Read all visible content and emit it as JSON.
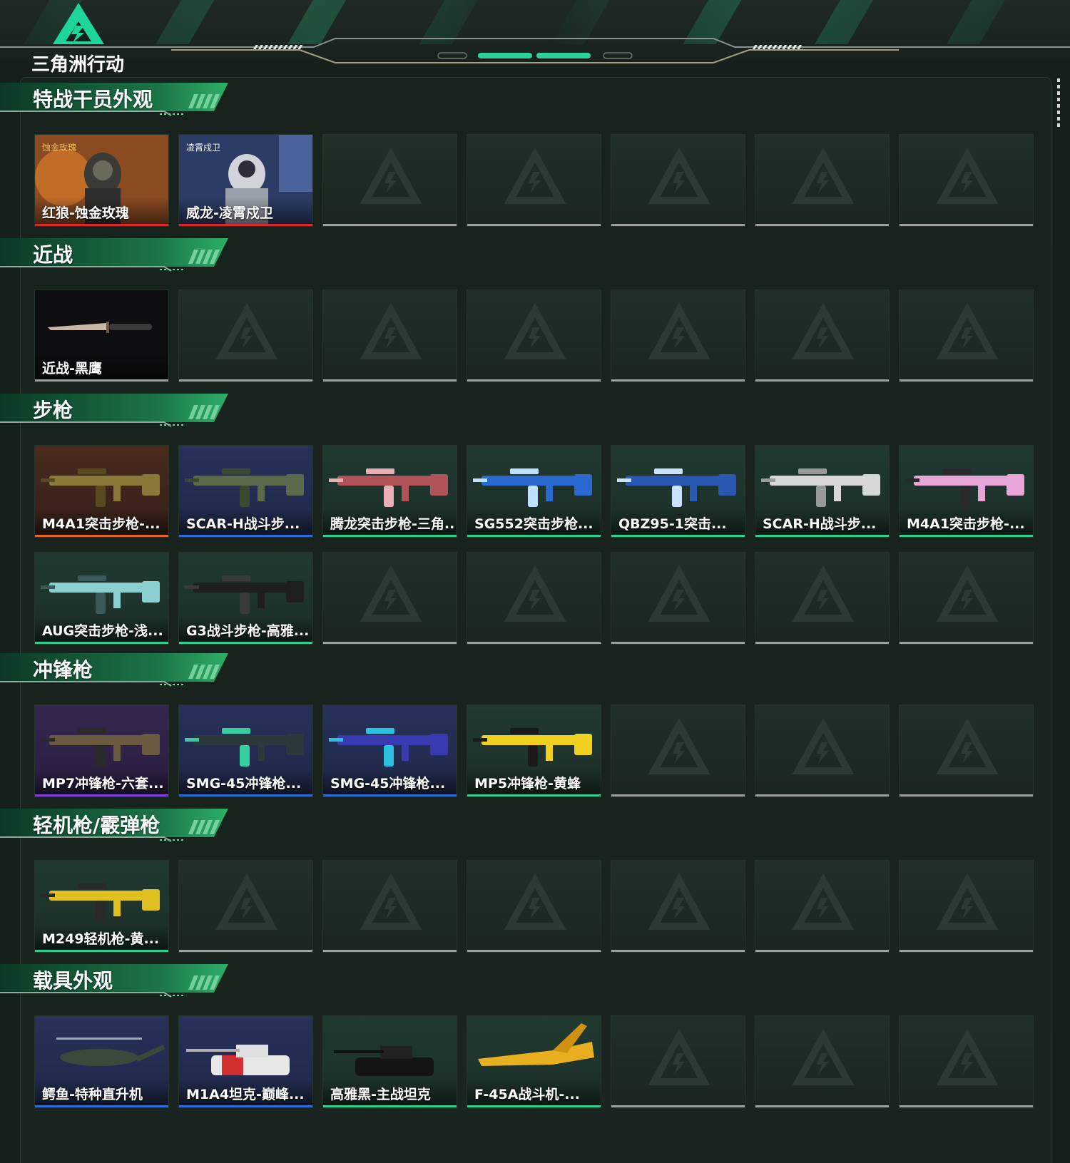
{
  "brand": {
    "name": "三角洲行动"
  },
  "colors": {
    "gold": "#e0632a",
    "red": "#d8262a",
    "blue": "#2e6bd6",
    "green": "#2fcf8b",
    "purple": "#7b3fe0",
    "gray": "#9aa19d",
    "accent": "#22c98a"
  },
  "sections": [
    {
      "title": "特战干员外观",
      "rows": [
        [
          {
            "label": "红狼-蚀金玫瑰",
            "rarity": "red",
            "art": "operator-redwolf"
          },
          {
            "label": "威龙-凌霄戍卫",
            "rarity": "red",
            "art": "operator-weilong"
          },
          null,
          null,
          null,
          null,
          null
        ]
      ]
    },
    {
      "title": "近战",
      "rows": [
        [
          {
            "label": "近战-黑鹰",
            "rarity": "gray",
            "art": "knife"
          },
          null,
          null,
          null,
          null,
          null,
          null
        ]
      ]
    },
    {
      "title": "步枪",
      "rows": [
        [
          {
            "label": "M4A1突击步枪-...",
            "rarity": "gold",
            "art": "rifle-gold"
          },
          {
            "label": "SCAR-H战斗步...",
            "rarity": "blue",
            "art": "rifle-green"
          },
          {
            "label": "腾龙突击步枪-三角...",
            "rarity": "green",
            "art": "rifle-red"
          },
          {
            "label": "SG552突击步枪...",
            "rarity": "green",
            "art": "rifle-blue"
          },
          {
            "label": "QBZ95-1突击...",
            "rarity": "green",
            "art": "bullpup-blue"
          },
          {
            "label": "SCAR-H战斗步...",
            "rarity": "green",
            "art": "rifle-white"
          },
          {
            "label": "M4A1突击步枪-...",
            "rarity": "green",
            "art": "rifle-pink"
          }
        ],
        [
          {
            "label": "AUG突击步枪-浅...",
            "rarity": "green",
            "art": "aug-teal"
          },
          {
            "label": "G3战斗步枪-高雅...",
            "rarity": "green",
            "art": "rifle-black"
          },
          null,
          null,
          null,
          null,
          null
        ]
      ]
    },
    {
      "title": "冲锋枪",
      "rows": [
        [
          {
            "label": "MP7冲锋枪-六套...",
            "rarity": "purple",
            "art": "smg-camo"
          },
          {
            "label": "SMG-45冲锋枪...",
            "rarity": "blue",
            "art": "smg-teal"
          },
          {
            "label": "SMG-45冲锋枪...",
            "rarity": "blue",
            "art": "smg-galaxy"
          },
          {
            "label": "MP5冲锋枪-黄蜂",
            "rarity": "green",
            "art": "smg-yellow"
          },
          null,
          null,
          null
        ]
      ]
    },
    {
      "title": "轻机枪/霰弹枪",
      "rows": [
        [
          {
            "label": "M249轻机枪-黄...",
            "rarity": "green",
            "art": "lmg-yellow"
          },
          null,
          null,
          null,
          null,
          null,
          null
        ]
      ]
    },
    {
      "title": "载具外观",
      "rows": [
        [
          {
            "label": "鳄鱼-特种直升机",
            "rarity": "blue",
            "art": "helicopter"
          },
          {
            "label": "M1A4坦克-巅峰...",
            "rarity": "blue",
            "art": "tank-red"
          },
          {
            "label": "高雅黑-主战坦克",
            "rarity": "green",
            "art": "tank-black"
          },
          {
            "label": "F-45A战斗机-...",
            "rarity": "green",
            "art": "jet-yellow"
          },
          null,
          null,
          null
        ]
      ]
    }
  ]
}
